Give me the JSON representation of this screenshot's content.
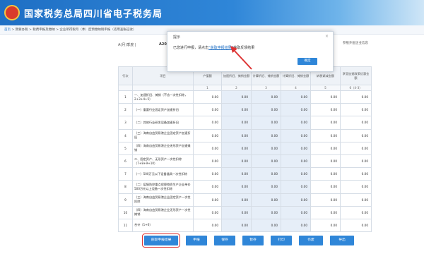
{
  "site": {
    "title": "国家税务总局四川省电子税务局"
  },
  "breadcrumb": {
    "home": "首页",
    "path": " > 我要办税 > 税费申报及缴纳 > 企业所得税月（季）度预缴纳税申报（适用查账征收）"
  },
  "sheet": {
    "tag": "A(月)季度 |",
    "code": "A200000",
    "corp_label": "参股外国企业信息"
  },
  "dialog": {
    "title": "提示",
    "close": "×",
    "msg_before": "已您进行申报，请点击",
    "link": "“获取申报结果”",
    "msg_after": "获取反馈结果",
    "ok": "确定"
  },
  "table": {
    "headers": [
      "行次",
      "项目",
      "产值额",
      "加速折旧、摊销金额",
      "计算折旧、摊销金额",
      "计算折旧、摊销金额",
      "纳税调减金额",
      "享受加速政策优惠金额"
    ],
    "colnums": [
      "",
      "",
      "1",
      "2",
      "3",
      "4",
      "5",
      "6（4-3）"
    ],
    "rows": [
      {
        "no": "1",
        "item": "一、加速折旧、摊销（不含一次性扣除，2+3+4+5）",
        "vals": [
          "0.00",
          "0.00",
          "0.00",
          "0.00",
          "0.00",
          "0.00"
        ]
      },
      {
        "no": "2",
        "item": "（一）重要行业固定资产加速折旧",
        "vals": [
          "0.00",
          "0.00",
          "0.00",
          "0.00",
          "0.00",
          "0.00"
        ]
      },
      {
        "no": "3",
        "item": "（二）其他行业研发设备加速折旧",
        "vals": [
          "0.00",
          "0.00",
          "0.00",
          "0.00",
          "0.00",
          "0.00"
        ]
      },
      {
        "no": "4",
        "item": "（三）海南自由贸易港企业固定资产加速折旧",
        "vals": [
          "0.00",
          "0.00",
          "0.00",
          "0.00",
          "0.00",
          "0.00"
        ]
      },
      {
        "no": "5",
        "item": "（四）海南自由贸易港企业无形资产加速摊销",
        "vals": [
          "0.00",
          "0.00",
          "0.00",
          "0.00",
          "0.00",
          "0.00"
        ]
      },
      {
        "no": "6",
        "item": "二、固定资产、无形资产一次性扣除（7+8+9+10）",
        "vals": [
          "0.00",
          "0.00",
          "0.00",
          "0.00",
          "0.00",
          "0.00"
        ]
      },
      {
        "no": "7",
        "item": "（一）500万元以下设备器具一次性扣除",
        "vals": [
          "0.00",
          "0.00",
          "0.00",
          "0.00",
          "0.00",
          "0.00"
        ]
      },
      {
        "no": "8",
        "item": "（二）疫情防控重点保障物资生产企业单价500万元以上设备一次性扣除",
        "vals": [
          "0.00",
          "0.00",
          "0.00",
          "0.00",
          "0.00",
          "0.00"
        ]
      },
      {
        "no": "9",
        "item": "（三）海南自由贸易港企业固定资产一次性扣除",
        "vals": [
          "0.00",
          "0.00",
          "0.00",
          "0.00",
          "0.00",
          "0.00"
        ]
      },
      {
        "no": "10",
        "item": "（四）海南自由贸易港企业无形资产一次性摊销",
        "vals": [
          "0.00",
          "0.00",
          "0.00",
          "0.00",
          "0.00",
          "0.00"
        ]
      },
      {
        "no": "11",
        "item": "合计（1+6）",
        "vals": [
          "0.00",
          "0.00",
          "0.00",
          "0.00",
          "0.00",
          "0.00"
        ]
      }
    ]
  },
  "buttons": [
    "获取申报结果",
    "申报",
    "保存",
    "暂存",
    "打印",
    "作废",
    "导出"
  ],
  "colors": {
    "accent": "#2f86d8",
    "highlight": "#d33333"
  }
}
